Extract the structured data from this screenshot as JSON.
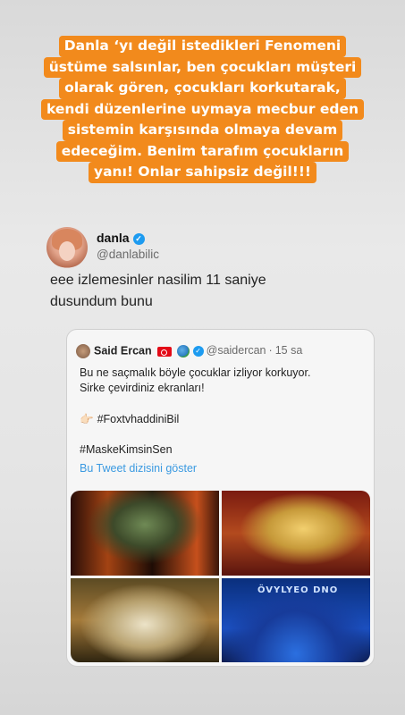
{
  "caption": {
    "lines": [
      "Danla ‘yı değil istedikleri Fenomeni",
      "üstüme salsınlar, ben çocukları müşteri",
      "olarak gören, çocukları korkutarak,",
      "kendi düzenlerine uymaya mecbur eden",
      "sistemin karşısında olmaya devam",
      "edeceğim. Benim tarafım çocukların",
      "yanı! Onlar sahipsiz değil!!!"
    ],
    "background": "#f28a1c"
  },
  "tweet": {
    "username": "danla",
    "handle": "@danlabilic",
    "text_line1": "eee izlemesinler nasilim 11 saniye",
    "text_line2": "dusundum bunu"
  },
  "quote": {
    "name": "Said Ercan",
    "handle": "@saidercan",
    "separator": "·",
    "time": "15 sa",
    "line1": "Bu ne saçmalık böyle çocuklar izliyor korkuyor.",
    "line2": "Sirke çevirdiniz ekranları!",
    "pointer": "👉🏻",
    "hashtag1": "#FoxtvhaddiniBil",
    "hashtag2": "#MaskeKimsinSen",
    "show_thread": "Bu Tweet dizisini göster"
  },
  "media": {
    "stage_text": "ÖVYLYEO   DNO"
  },
  "icons": {
    "verified": "verified-check-icon",
    "flag": "turkey-flag-icon",
    "globe": "globe-icon"
  }
}
